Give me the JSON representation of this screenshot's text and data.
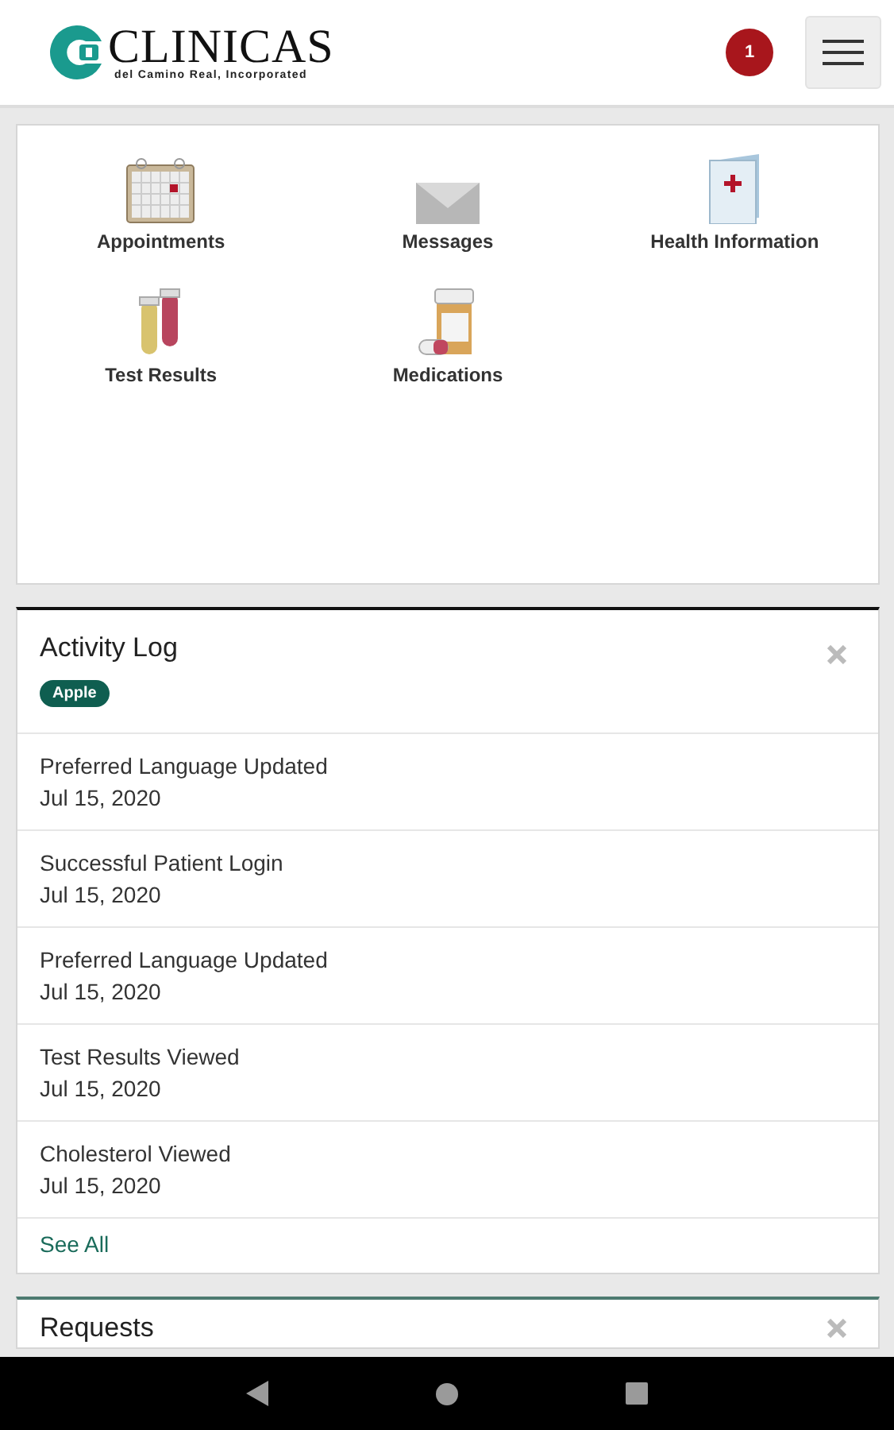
{
  "header": {
    "logo_name": "CLINICAS",
    "logo_tagline": "del Camino Real, Incorporated",
    "notification_count": "1"
  },
  "shortcuts": [
    {
      "label": "Appointments",
      "kind": "calendar"
    },
    {
      "label": "Messages",
      "kind": "envelope"
    },
    {
      "label": "Health Information",
      "kind": "booklet"
    },
    {
      "label": "Test Results",
      "kind": "tubes"
    },
    {
      "label": "Medications",
      "kind": "pills"
    }
  ],
  "activity_log": {
    "title": "Activity Log",
    "tag": "Apple",
    "items": [
      {
        "event": "Preferred Language Updated",
        "date": "Jul 15, 2020"
      },
      {
        "event": "Successful Patient Login",
        "date": "Jul 15, 2020"
      },
      {
        "event": "Preferred Language Updated",
        "date": "Jul 15, 2020"
      },
      {
        "event": "Test Results Viewed",
        "date": "Jul 15, 2020"
      },
      {
        "event": "Cholesterol Viewed",
        "date": "Jul 15, 2020"
      }
    ],
    "link": "See All"
  },
  "requests": {
    "title": "Requests"
  }
}
